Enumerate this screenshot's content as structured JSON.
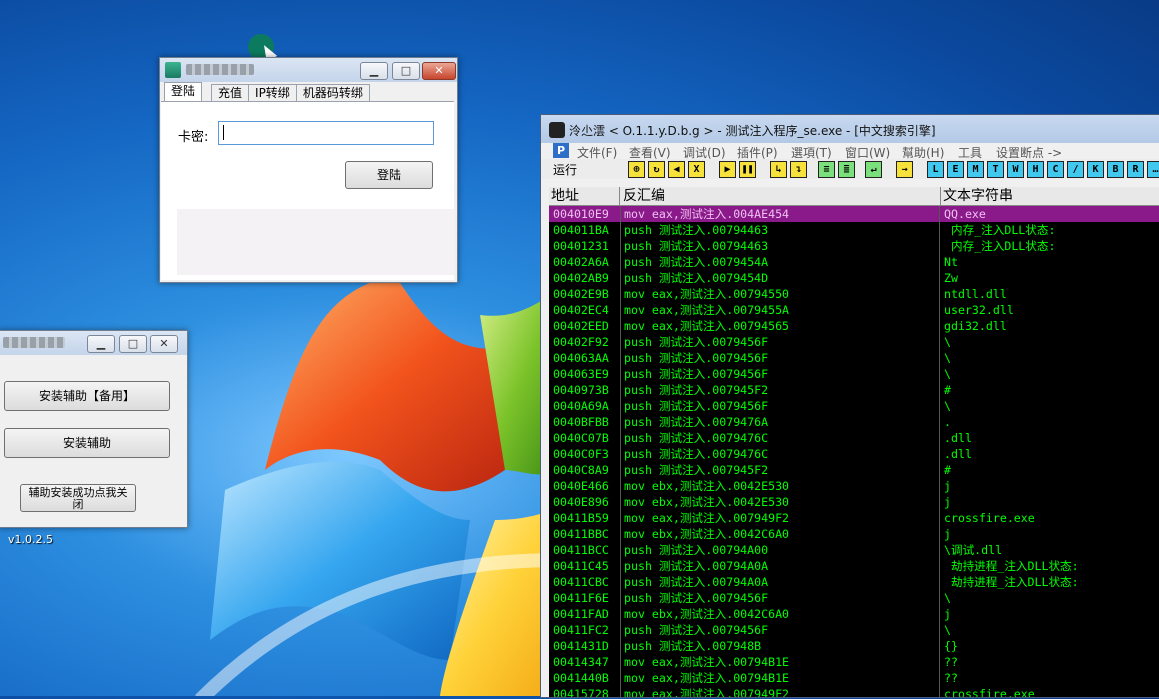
{
  "login_window": {
    "tabs": [
      "登陆",
      "充值",
      "IP转绑",
      "机器码转绑"
    ],
    "card_label": "卡密:",
    "card_value": "",
    "login_button": "登陆",
    "controls": {
      "minimize": "▁",
      "maximize": "□",
      "close": "✕"
    }
  },
  "installer_window": {
    "button_backup": "安装辅助【备用】",
    "button_install": "安装辅助",
    "button_close_line1": "辅助安装成功点我关",
    "button_close_line2": "闭",
    "controls": {
      "minimize": "▁",
      "maximize": "□",
      "close": "✕"
    }
  },
  "desktop": {
    "version_label": "v1.0.2.5"
  },
  "debugger": {
    "title": "泠尐澐 < O.1.1.y.D.b.g > - 测试注入程序_se.exe - [中文搜索引擎]",
    "menu": [
      "文件(F)",
      "查看(V)",
      "调试(D)",
      "插件(P)",
      "選項(T)",
      "窗口(W)",
      "幫助(H)",
      "工具",
      "设置断点 ->"
    ],
    "run_label": "运行",
    "toolbar_letters": [
      "L",
      "E",
      "M",
      "T",
      "W",
      "H",
      "C",
      "/",
      "K",
      "B",
      "R"
    ],
    "columns": [
      "地址",
      "反汇编",
      "文本字符串"
    ],
    "rows": [
      {
        "addr": "004010E9",
        "asm": "mov eax,测试注入.004AE454",
        "text": "QQ.exe"
      },
      {
        "addr": "004011BA",
        "asm": "push 测试注入.00794463",
        "text": " 内存_注入DLL状态:"
      },
      {
        "addr": "00401231",
        "asm": "push 测试注入.00794463",
        "text": " 内存_注入DLL状态:"
      },
      {
        "addr": "00402A6A",
        "asm": "push 测试注入.0079454A",
        "text": "Nt"
      },
      {
        "addr": "00402AB9",
        "asm": "push 测试注入.0079454D",
        "text": "Zw"
      },
      {
        "addr": "00402E9B",
        "asm": "mov eax,测试注入.00794550",
        "text": "ntdll.dll"
      },
      {
        "addr": "00402EC4",
        "asm": "mov eax,测试注入.0079455A",
        "text": "user32.dll"
      },
      {
        "addr": "00402EED",
        "asm": "mov eax,测试注入.00794565",
        "text": "gdi32.dll"
      },
      {
        "addr": "00402F92",
        "asm": "push 测试注入.0079456F",
        "text": "\\"
      },
      {
        "addr": "004063AA",
        "asm": "push 测试注入.0079456F",
        "text": "\\"
      },
      {
        "addr": "004063E9",
        "asm": "push 测试注入.0079456F",
        "text": "\\"
      },
      {
        "addr": "0040973B",
        "asm": "push 测试注入.007945F2",
        "text": "#"
      },
      {
        "addr": "0040A69A",
        "asm": "push 测试注入.0079456F",
        "text": "\\"
      },
      {
        "addr": "0040BFBB",
        "asm": "push 测试注入.0079476A",
        "text": "."
      },
      {
        "addr": "0040C07B",
        "asm": "push 测试注入.0079476C",
        "text": ".dll"
      },
      {
        "addr": "0040C0F3",
        "asm": "push 测试注入.0079476C",
        "text": ".dll"
      },
      {
        "addr": "0040C8A9",
        "asm": "push 测试注入.007945F2",
        "text": "#"
      },
      {
        "addr": "0040E466",
        "asm": "mov ebx,测试注入.0042E530",
        "text": "j"
      },
      {
        "addr": "0040E896",
        "asm": "mov ebx,测试注入.0042E530",
        "text": "j"
      },
      {
        "addr": "00411B59",
        "asm": "mov eax,测试注入.007949F2",
        "text": "crossfire.exe"
      },
      {
        "addr": "00411BBC",
        "asm": "mov ebx,测试注入.0042C6A0",
        "text": "j"
      },
      {
        "addr": "00411BCC",
        "asm": "push 测试注入.00794A00",
        "text": "\\调试.dll"
      },
      {
        "addr": "00411C45",
        "asm": "push 测试注入.00794A0A",
        "text": " 劫持进程_注入DLL状态:"
      },
      {
        "addr": "00411CBC",
        "asm": "push 测试注入.00794A0A",
        "text": " 劫持进程_注入DLL状态:"
      },
      {
        "addr": "00411F6E",
        "asm": "push 测试注入.0079456F",
        "text": "\\"
      },
      {
        "addr": "00411FAD",
        "asm": "mov ebx,测试注入.0042C6A0",
        "text": "j"
      },
      {
        "addr": "00411FC2",
        "asm": "push 测试注入.0079456F",
        "text": "\\"
      },
      {
        "addr": "0041431D",
        "asm": "push 测试注入.007948B",
        "text": "{}"
      },
      {
        "addr": "00414347",
        "asm": "mov eax,测试注入.00794B1E",
        "text": "??"
      },
      {
        "addr": "0041440B",
        "asm": "mov eax,测试注入.00794B1E",
        "text": "??"
      },
      {
        "addr": "00415728",
        "asm": "mov eax,测试注入.007949F2",
        "text": "crossfire.exe"
      }
    ]
  }
}
